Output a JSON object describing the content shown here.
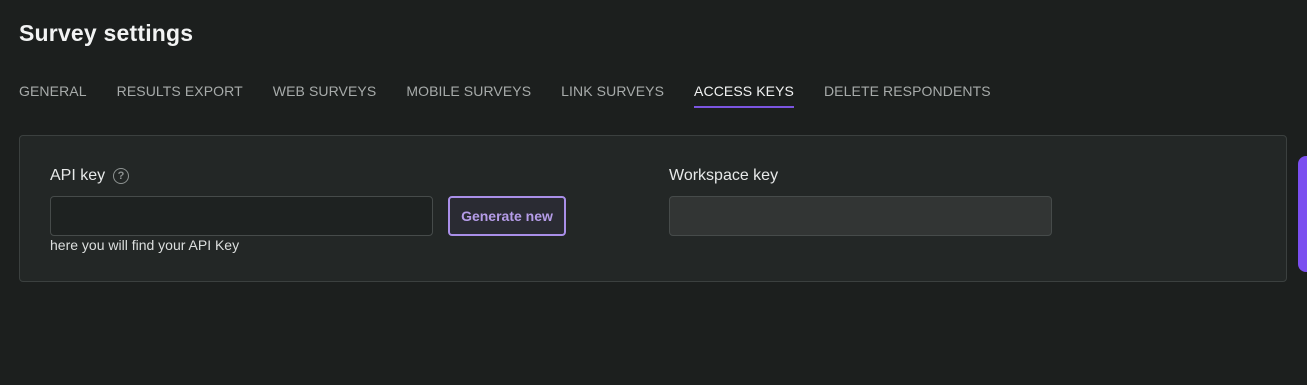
{
  "header": {
    "title": "Survey settings"
  },
  "tabs": [
    {
      "label": "GENERAL"
    },
    {
      "label": "RESULTS EXPORT"
    },
    {
      "label": "WEB SURVEYS"
    },
    {
      "label": "MOBILE SURVEYS"
    },
    {
      "label": "LINK SURVEYS"
    },
    {
      "label": "ACCESS KEYS"
    },
    {
      "label": "DELETE RESPONDENTS"
    }
  ],
  "active_tab": "ACCESS KEYS",
  "access_keys": {
    "api_key": {
      "label": "API key",
      "help_icon": "question-circle-icon",
      "value": "",
      "hint": "here you will find your API Key",
      "generate_label": "Generate new"
    },
    "workspace_key": {
      "label": "Workspace key",
      "value": ""
    }
  },
  "colors": {
    "background": "#1c1f1e",
    "accent": "#7b55e0",
    "button_text": "#b59ce8",
    "side_tab": "#7b4ff0"
  }
}
